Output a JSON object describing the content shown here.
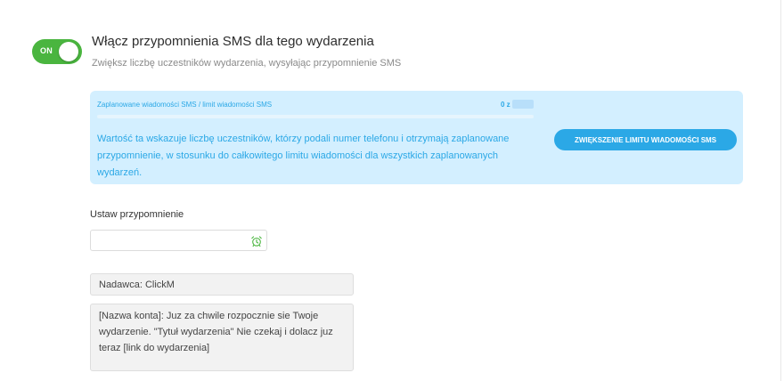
{
  "toggle": {
    "label": "ON",
    "state": "on"
  },
  "header": {
    "title": "Włącz przypomnienia SMS dla tego wydarzenia",
    "subtitle": "Zwiększ liczbę uczestników wydarzenia, wysyłając przypomnienie SMS"
  },
  "sms_limit": {
    "title": "Zaplanowane wiadomości SMS / limit wiadomości SMS",
    "count_prefix": "0 z",
    "progress_fraction": 0,
    "description": "Wartość ta wskazuje liczbę uczestników, którzy podali numer telefonu i otrzymają zaplanowane przypomnienie, w stosunku do całkowitego limitu wiadomości dla wszystkich zaplanowanych wydarzeń.",
    "button_label": "ZWIĘKSZENIE LIMITU WIADOMOŚCI SMS"
  },
  "reminder": {
    "label": "Ustaw przypomnienie",
    "value": "",
    "icon": "alarm-clock-icon"
  },
  "sender": {
    "text": "Nadawca: ClickM"
  },
  "message": {
    "text": "[Nazwa konta]: Juz za chwile rozpocznie sie Twoje wydarzenie. \"Tytuł wydarzenia\" Nie czekaj i dolacz juz teraz [link do wydarzenia]"
  },
  "colors": {
    "toggle_on": "#4ab53f",
    "accent": "#2ba8e6",
    "info_background": "#d3efff"
  }
}
